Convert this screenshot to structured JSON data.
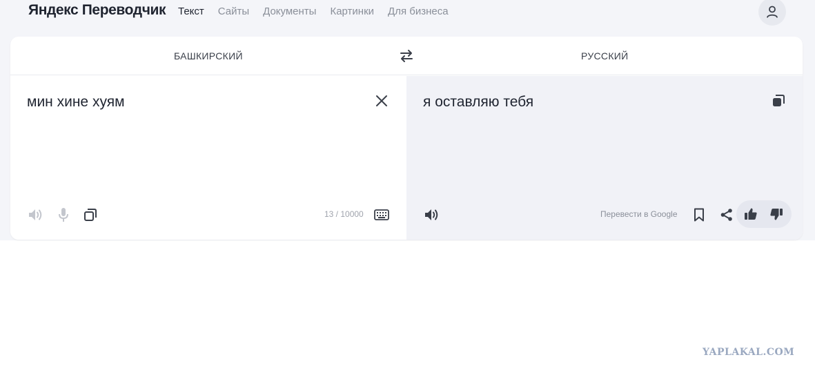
{
  "app": {
    "logo": "Яндекс Переводчик"
  },
  "nav": {
    "items": [
      "Текст",
      "Сайты",
      "Документы",
      "Картинки",
      "Для бизнеса"
    ],
    "active_index": 0
  },
  "languages": {
    "source": "БАШКИРСКИЙ",
    "target": "РУССКИЙ"
  },
  "source": {
    "text": "мин хине хуям",
    "counter": "13 / 10000"
  },
  "target": {
    "text": "я оставляю тебя",
    "google_link": "Перевести в Google"
  },
  "watermark": "YAPLAKAL.COM",
  "icons": {
    "user": "user-icon",
    "swap": "swap-arrows-icon",
    "clear": "close-icon",
    "copy": "copy-icon",
    "speaker": "speaker-icon",
    "microphone": "microphone-icon",
    "keyboard": "keyboard-icon",
    "bookmark": "bookmark-icon",
    "share": "share-icon",
    "like": "thumbs-up-icon",
    "dislike": "thumbs-down-icon"
  },
  "colors": {
    "background": "#f4f5f9",
    "card": "#ffffff",
    "result_pane": "#f1f2f7",
    "text": "#1f2430",
    "muted": "#8a8f99"
  }
}
